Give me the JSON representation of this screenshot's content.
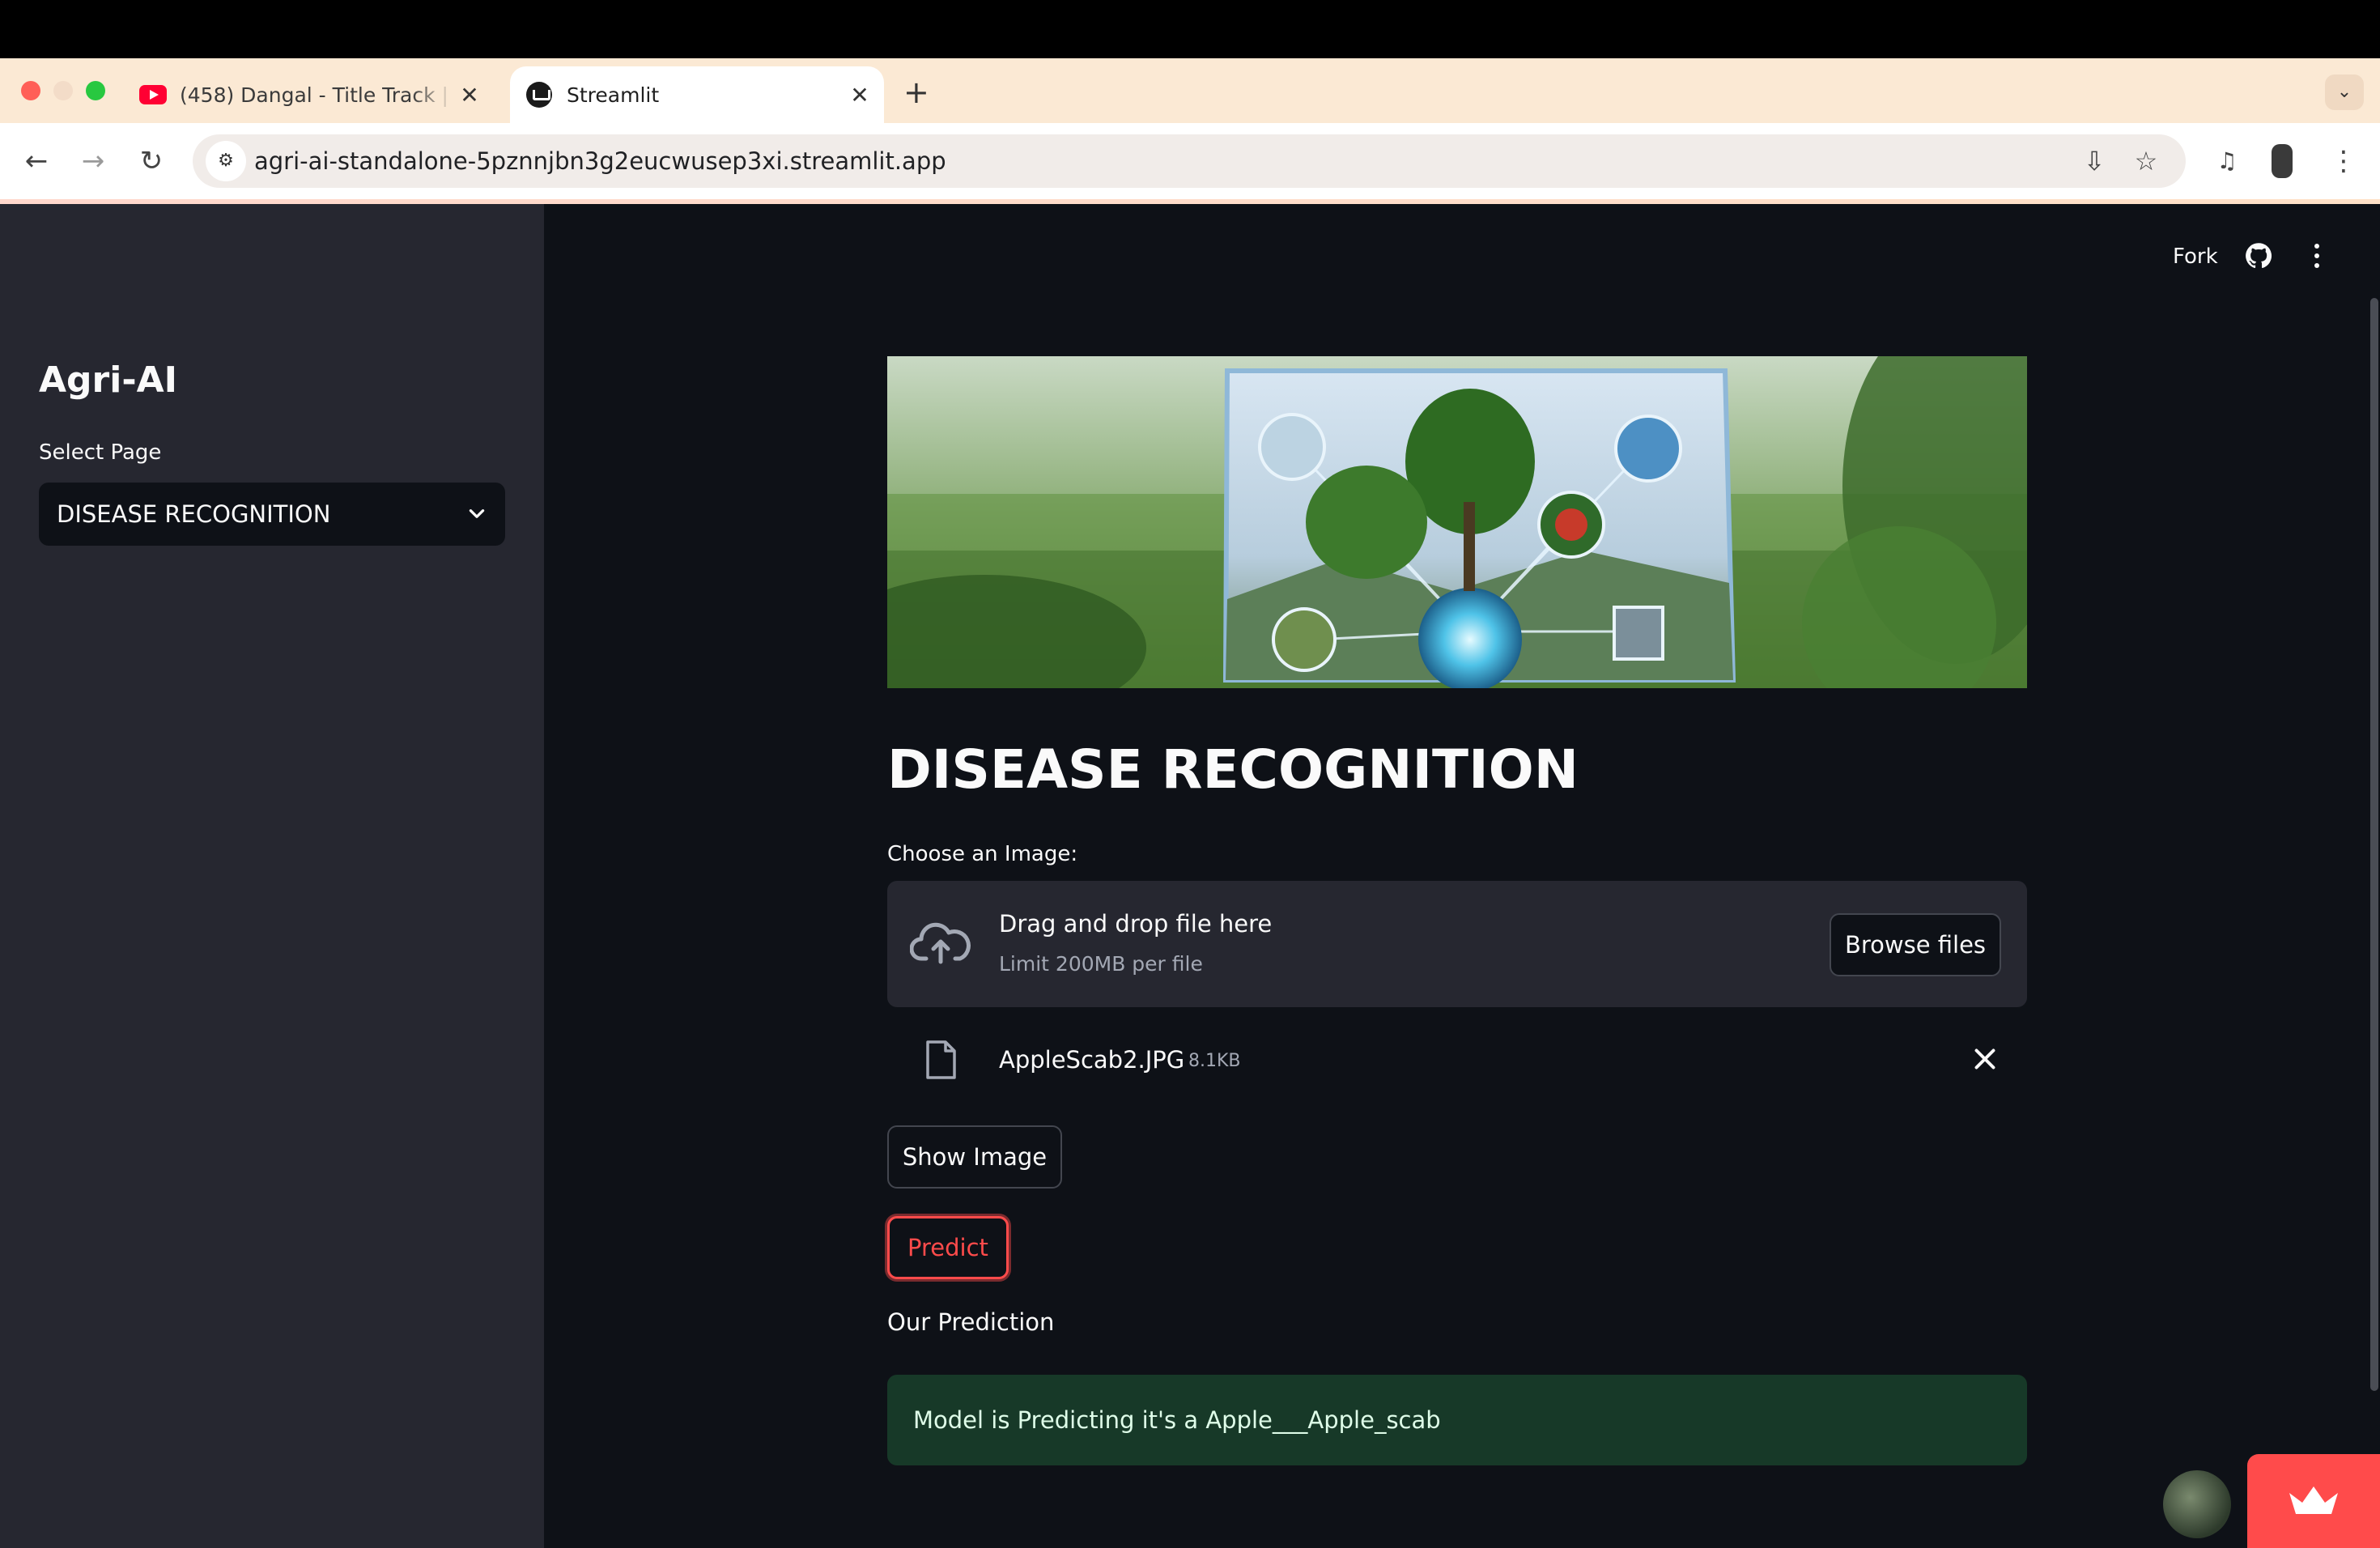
{
  "browser": {
    "tabs": [
      {
        "title": "(458) Dangal - Title Track | Ly",
        "active": false
      },
      {
        "title": "Streamlit",
        "active": true
      }
    ],
    "url": "agri-ai-standalone-5pznnjbn3g2eucwusep3xi.streamlit.app"
  },
  "header": {
    "fork_label": "Fork"
  },
  "sidebar": {
    "title": "Agri-AI",
    "select_label": "Select Page",
    "select_value": "DISEASE RECOGNITION"
  },
  "main": {
    "heading": "DISEASE RECOGNITION",
    "uploader": {
      "label": "Choose an Image:",
      "drop_title": "Drag and drop file here",
      "drop_limit": "Limit 200MB per file",
      "browse_label": "Browse files"
    },
    "file": {
      "name": "AppleScab2.JPG",
      "size": "8.1KB"
    },
    "show_image_label": "Show Image",
    "predict_label": "Predict",
    "prediction_label": "Our Prediction",
    "prediction_text": "Model is Predicting it's a Apple___Apple_scab"
  },
  "colors": {
    "primary": "#ff4b4b",
    "app_bg": "#0e1117",
    "sidebar_bg": "#262730",
    "success_bg": "#173928"
  }
}
